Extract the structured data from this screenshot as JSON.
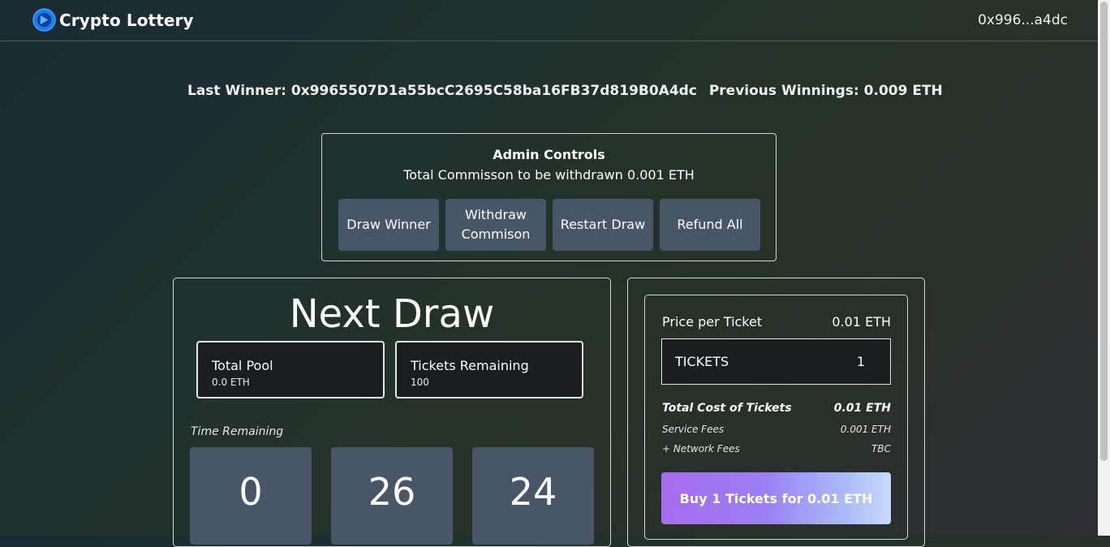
{
  "header": {
    "app_title": "Crypto Lottery",
    "wallet_address": "0x996...a4dc",
    "logo_icon": "crypto-logo-icon"
  },
  "winner": {
    "last_winner": "Last Winner: 0x9965507D1a55bcC2695C58ba16FB37d819B0A4dc",
    "previous_winnings": "Previous Winnings: 0.009 ETH"
  },
  "admin": {
    "title": "Admin Controls",
    "commission_text": "Total Commisson to be withdrawn 0.001 ETH",
    "buttons": [
      "Draw Winner",
      "Withdraw Commison",
      "Restart Draw",
      "Refund All"
    ]
  },
  "draw": {
    "title": "Next Draw",
    "total_pool_label": "Total Pool",
    "total_pool_value": "0.0 ETH",
    "tickets_remaining_label": "Tickets Remaining",
    "tickets_remaining_value": "100",
    "time_label": "Time Remaining",
    "time": {
      "hours": "0",
      "minutes": "26",
      "seconds": "24"
    }
  },
  "purchase": {
    "price_label": "Price per Ticket",
    "price_value": "0.01 ETH",
    "tickets_label": "TICKETS",
    "tickets_qty": "1",
    "total_cost_label": "Total Cost of Tickets",
    "total_cost_value": "0.01 ETH",
    "service_fees_label": "Service Fees",
    "service_fees_value": "0.001 ETH",
    "network_fees_label": "+ Network Fees",
    "network_fees_value": "TBC",
    "buy_button": "Buy 1 Tickets for 0.01 ETH"
  },
  "colors": {
    "panel_button": "#485668",
    "buy_gradient_start": "#a66cf0",
    "buy_gradient_end": "#c8dafa"
  }
}
